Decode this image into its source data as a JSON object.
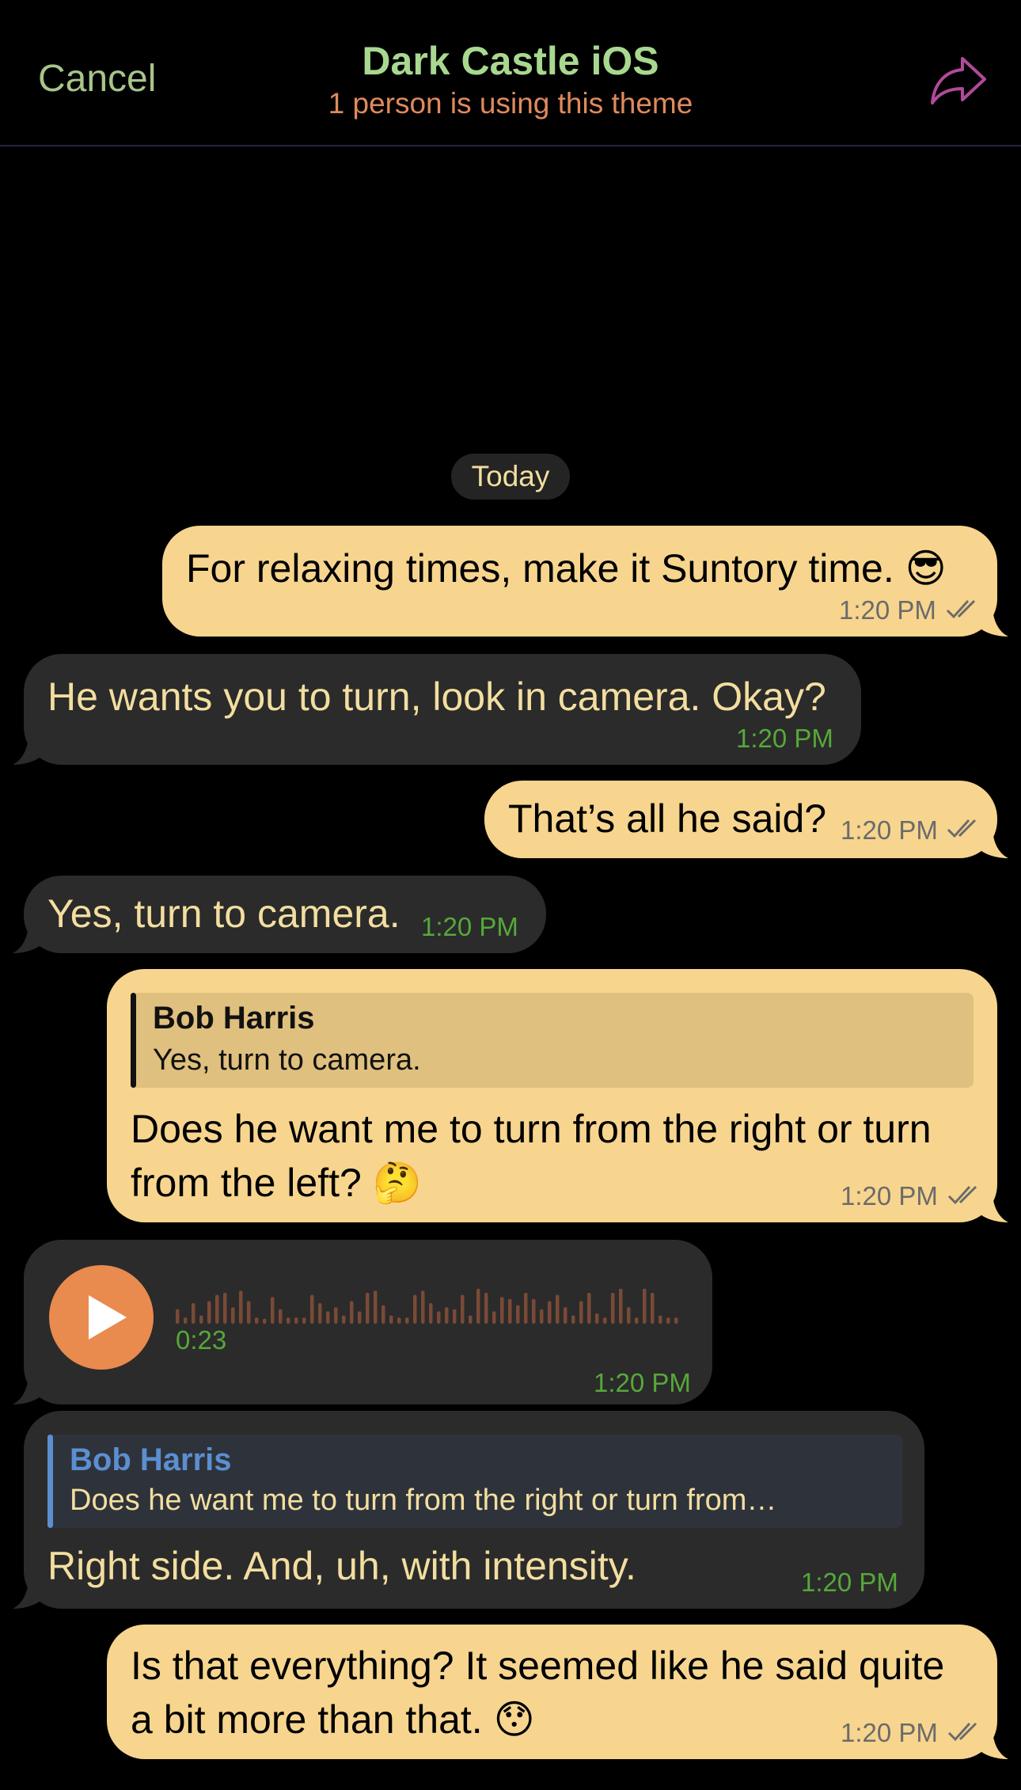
{
  "header": {
    "cancel_label": "Cancel",
    "title": "Dark Castle iOS",
    "subtitle": "1 person is using this theme",
    "share_icon": "share-arrow-icon"
  },
  "date_label": "Today",
  "messages": [
    {
      "direction": "out",
      "text": "For relaxing times, make it Suntory time. 😎",
      "time": "1:20 PM",
      "status": "read"
    },
    {
      "direction": "in",
      "text": "He wants you to turn, look in camera. Okay?",
      "time": "1:20 PM"
    },
    {
      "direction": "out",
      "text": "That’s all he said?",
      "time": "1:20 PM",
      "status": "read"
    },
    {
      "direction": "in",
      "text": "Yes, turn to camera.",
      "time": "1:20 PM"
    },
    {
      "direction": "out",
      "reply": {
        "name": "Bob Harris",
        "text": "Yes, turn to camera."
      },
      "text_line1": "Does he want me to turn from the right or turn",
      "text_line2": "from the left? 🤔",
      "time": "1:20 PM",
      "status": "read"
    },
    {
      "direction": "in",
      "type": "voice",
      "duration": "0:23",
      "time": "1:20 PM"
    },
    {
      "direction": "in",
      "reply": {
        "name": "Bob Harris",
        "text": "Does he want me to turn from the right or turn from…"
      },
      "text": "Right side. And, uh, with intensity.",
      "time": "1:20 PM"
    },
    {
      "direction": "out",
      "text_line1": "Is that everything? It seemed like he said quite",
      "text_line2": "a bit more than that. 😯",
      "time": "1:20 PM",
      "status": "read"
    }
  ],
  "colors": {
    "background": "#000000",
    "outgoing_bubble": "#f7d58e",
    "incoming_bubble": "#2b2b2b",
    "incoming_text": "#f3dea0",
    "incoming_time": "#56a83a",
    "title": "#a8d890",
    "subtitle": "#e08a5c",
    "cancel": "#a8c48a",
    "share_icon": "#b04a9a",
    "play_button": "#e98a4f",
    "reply_name_incoming": "#5b8fd1"
  }
}
